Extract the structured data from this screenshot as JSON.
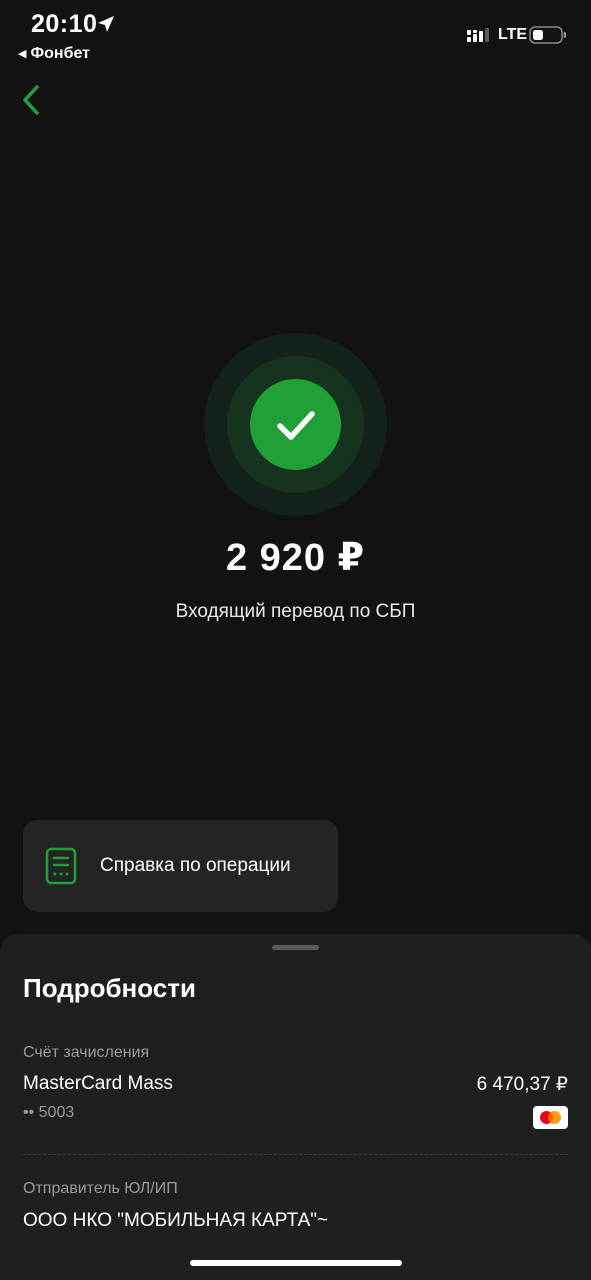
{
  "status_bar": {
    "time": "20:10",
    "back_app": "Фонбет",
    "network": "LTE"
  },
  "transfer": {
    "amount": "2 920 ₽",
    "description": "Входящий перевод по СБП"
  },
  "reference": {
    "label": "Справка по операции"
  },
  "details": {
    "title": "Подробности",
    "account_caption": "Счёт зачисления",
    "account_name": "MasterCard Mass",
    "account_balance": "6 470,37 ₽",
    "account_number": "•• 5003",
    "sender_caption": "Отправитель ЮЛ/ИП",
    "sender_name": "ООО НКО \"МОБИЛЬНАЯ КАРТА\"~"
  },
  "colors": {
    "accent": "#21a038",
    "background": "#121212",
    "sheet": "#1f1f1f"
  }
}
